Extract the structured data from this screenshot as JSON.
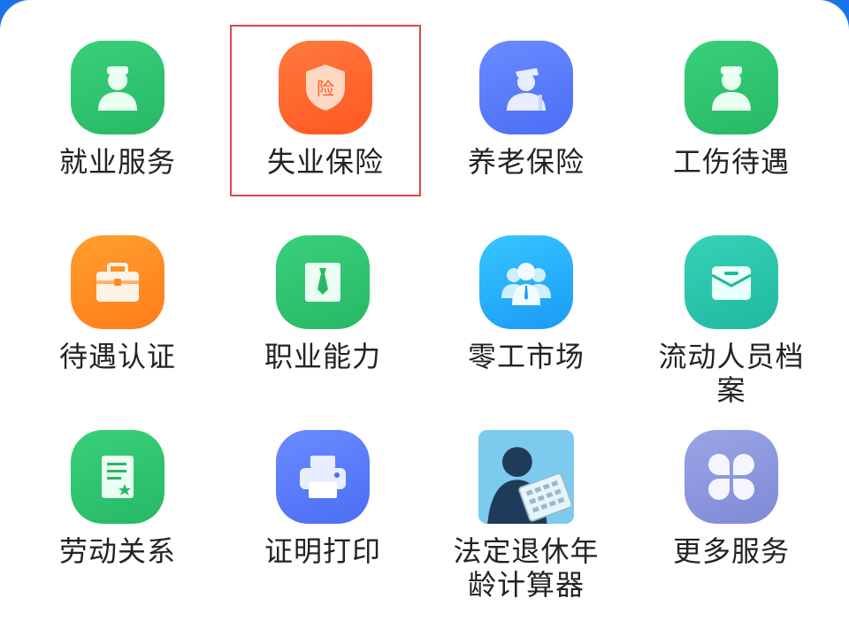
{
  "services": [
    {
      "label": "就业服务",
      "icon": "person-icon",
      "color": "#2fc46f"
    },
    {
      "label": "失业保险",
      "icon": "insurance-shield-icon",
      "color": "#ff5e28",
      "shield_text": "险",
      "highlighted": true
    },
    {
      "label": "养老保险",
      "icon": "elderly-person-icon",
      "color": "#5a7cfb"
    },
    {
      "label": "工伤待遇",
      "icon": "person-icon",
      "color": "#2fc46f"
    },
    {
      "label": "待遇认证",
      "icon": "briefcase-icon",
      "color": "#ff8a22"
    },
    {
      "label": "职业能力",
      "icon": "tie-certificate-icon",
      "color": "#2fc46f"
    },
    {
      "label": "零工市场",
      "icon": "people-group-icon",
      "color": "#26a8f7"
    },
    {
      "label": "流动人员档案",
      "icon": "folder-icon",
      "color": "#2cc6ab"
    },
    {
      "label": "劳动关系",
      "icon": "contract-icon",
      "color": "#2fc46f"
    },
    {
      "label": "证明打印",
      "icon": "printer-icon",
      "color": "#5a7cfb"
    },
    {
      "label": "法定退休年龄计算器",
      "icon": "calculator-photo-icon",
      "color": "#6cc3ea"
    },
    {
      "label": "更多服务",
      "icon": "grid-more-icon",
      "color": "#8b95dd"
    }
  ]
}
